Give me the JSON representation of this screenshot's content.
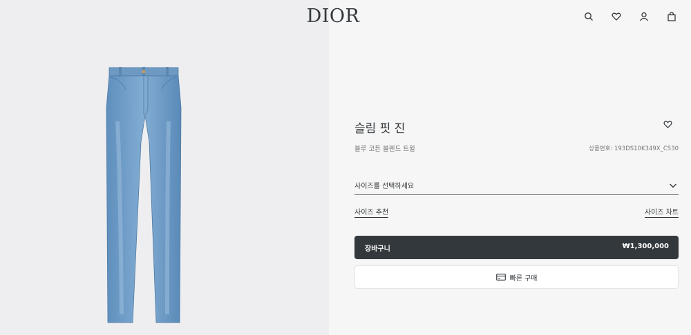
{
  "brand": {
    "logo_text": "DIOR"
  },
  "header": {
    "icons": [
      "search-icon",
      "heart-icon",
      "user-icon",
      "shopping-bag-icon"
    ]
  },
  "product": {
    "title": "슬림 핏 진",
    "subtitle": "블루 코튼 블렌드 트윌",
    "reference": "상품번호: 193DS10K349X_C530",
    "image": "blue-slim-fit-jeans"
  },
  "size": {
    "placeholder": "사이즈를 선택하세요",
    "recommendation_link": "사이즈 추천",
    "chart_link": "사이즈 차트"
  },
  "cart": {
    "label": "장바구니",
    "price": "₩1,300,000"
  },
  "quick_buy": {
    "label": "빠른 구매",
    "icon": "card-icon"
  },
  "colors": {
    "dark": "#33383c",
    "left_bg": "#eeeef0",
    "right_bg": "#f6f6f6",
    "denim": "#6a9cc9"
  }
}
